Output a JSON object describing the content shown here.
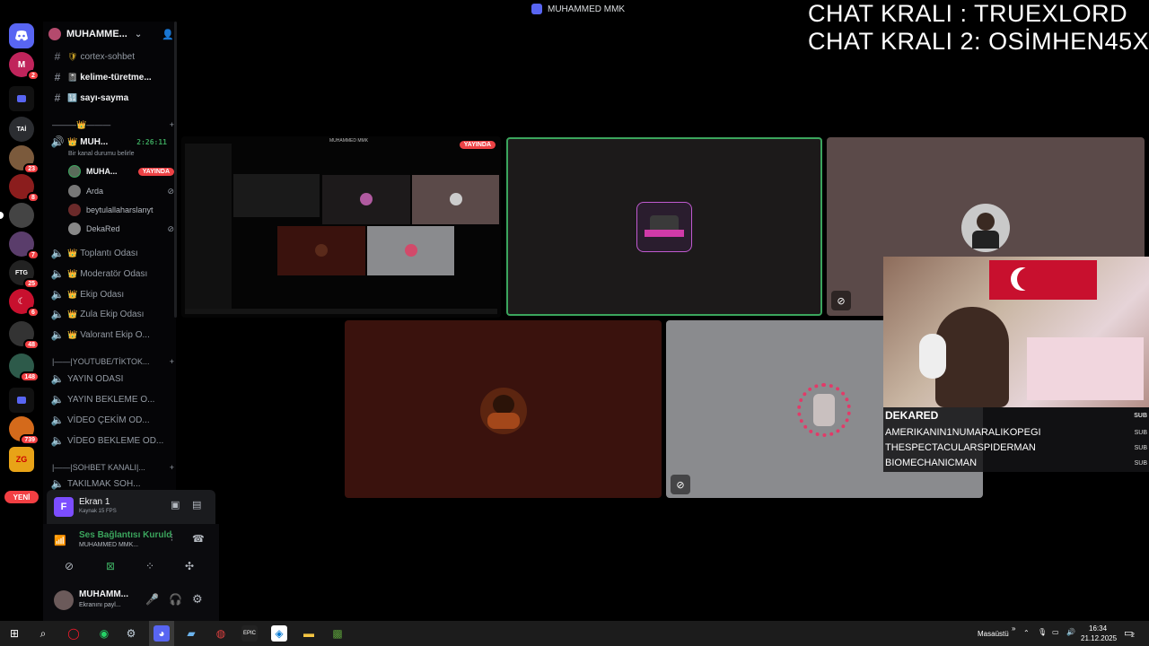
{
  "stream_title": "MUHAMMED MMK",
  "overlay": {
    "line1": "CHAT KRALI : TRUEXLORD",
    "line2": "CHAT KRALI 2: OSİMHEN45X"
  },
  "rail": {
    "badges": [
      "2",
      "23",
      "8",
      "7",
      "25",
      "6",
      "48",
      "148",
      "739"
    ],
    "labels": [
      "TAİ",
      "FTG",
      "ZG"
    ],
    "new_label": "YENİ"
  },
  "sidebar": {
    "guild_name": "MUHAMME...",
    "channels": [
      {
        "icon": "#",
        "emoji": "🛡",
        "name": "cortex-sohbet"
      },
      {
        "icon": "#",
        "emoji": "📓",
        "name": "kelime-türetme..."
      },
      {
        "icon": "#",
        "emoji": "🔢",
        "name": "sayı-sayma"
      }
    ],
    "category_1": "———👑———",
    "active_voice": {
      "name": "MUH...",
      "timer": "2:26:11",
      "status_hint": "Bir kanal durumu belirle"
    },
    "voice_users": [
      {
        "name": "MUHA...",
        "live": "YAYINDA"
      },
      {
        "name": "Arda"
      },
      {
        "name": "beytulallaharslanyt"
      },
      {
        "name": "DekaRed"
      }
    ],
    "voice_channels": [
      "Toplantı Odası",
      "Moderatör Odası",
      "Ekip Odası",
      "Zula Ekip Odası",
      "Valorant Ekip O..."
    ],
    "category_2": "YOUTUBE/TİKTOK...",
    "voice_channels_2": [
      "YAYIN ODASI",
      "YAYIN BEKLEME O...",
      "VİDEO ÇEKİM OD...",
      "VİDEO BEKLEME OD..."
    ],
    "category_3": "SOHBET KANALI|...",
    "voice_channels_3": [
      "TAKILMAK SOH..."
    ]
  },
  "stream_panel": {
    "title": "Ekran 1",
    "source": "Kaynak 15 FPS"
  },
  "voice_panel": {
    "status": "Ses Bağlantısı Kuruld",
    "channel": "MUHAMMED MMK..."
  },
  "user_panel": {
    "name": "MUHAMM...",
    "status": "Ekranını payl..."
  },
  "stage": {
    "live_badge": "YAYINDA",
    "mini_title": "MUHAMMED MMK"
  },
  "subs": {
    "top": "DEKARED",
    "rows": [
      "AMERIKANIN1NUMARALIKOPEGI",
      "THESPECTACULARSPIDERMAN",
      "BIOMECHANICMAN"
    ],
    "tag": "SUB"
  },
  "taskbar": {
    "desktop_label": "Masaüstü",
    "time": "16:34",
    "date": "21.12.2025",
    "notif_count": "2"
  },
  "colors": {
    "accent": "#5865f2",
    "live": "#ed4245",
    "speaking": "#3ba55d"
  }
}
